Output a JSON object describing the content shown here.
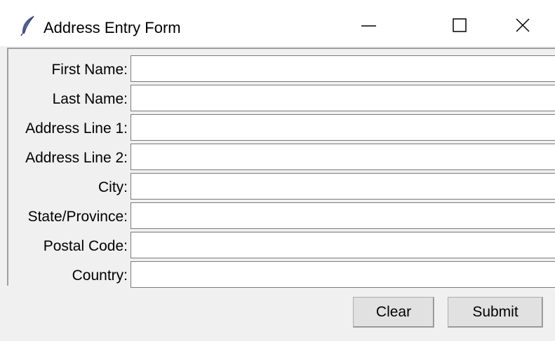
{
  "window": {
    "title": "Address Entry Form",
    "icon": "feather-icon",
    "controls": [
      "minimize-icon",
      "maximize-icon",
      "close-icon"
    ]
  },
  "form": {
    "fields": [
      {
        "label": "First Name:",
        "value": ""
      },
      {
        "label": "Last Name:",
        "value": ""
      },
      {
        "label": "Address Line 1:",
        "value": ""
      },
      {
        "label": "Address Line 2:",
        "value": ""
      },
      {
        "label": "City:",
        "value": ""
      },
      {
        "label": "State/Province:",
        "value": ""
      },
      {
        "label": "Postal Code:",
        "value": ""
      },
      {
        "label": "Country:",
        "value": ""
      }
    ]
  },
  "buttons": {
    "clear_label": "Clear",
    "submit_label": "Submit"
  }
}
